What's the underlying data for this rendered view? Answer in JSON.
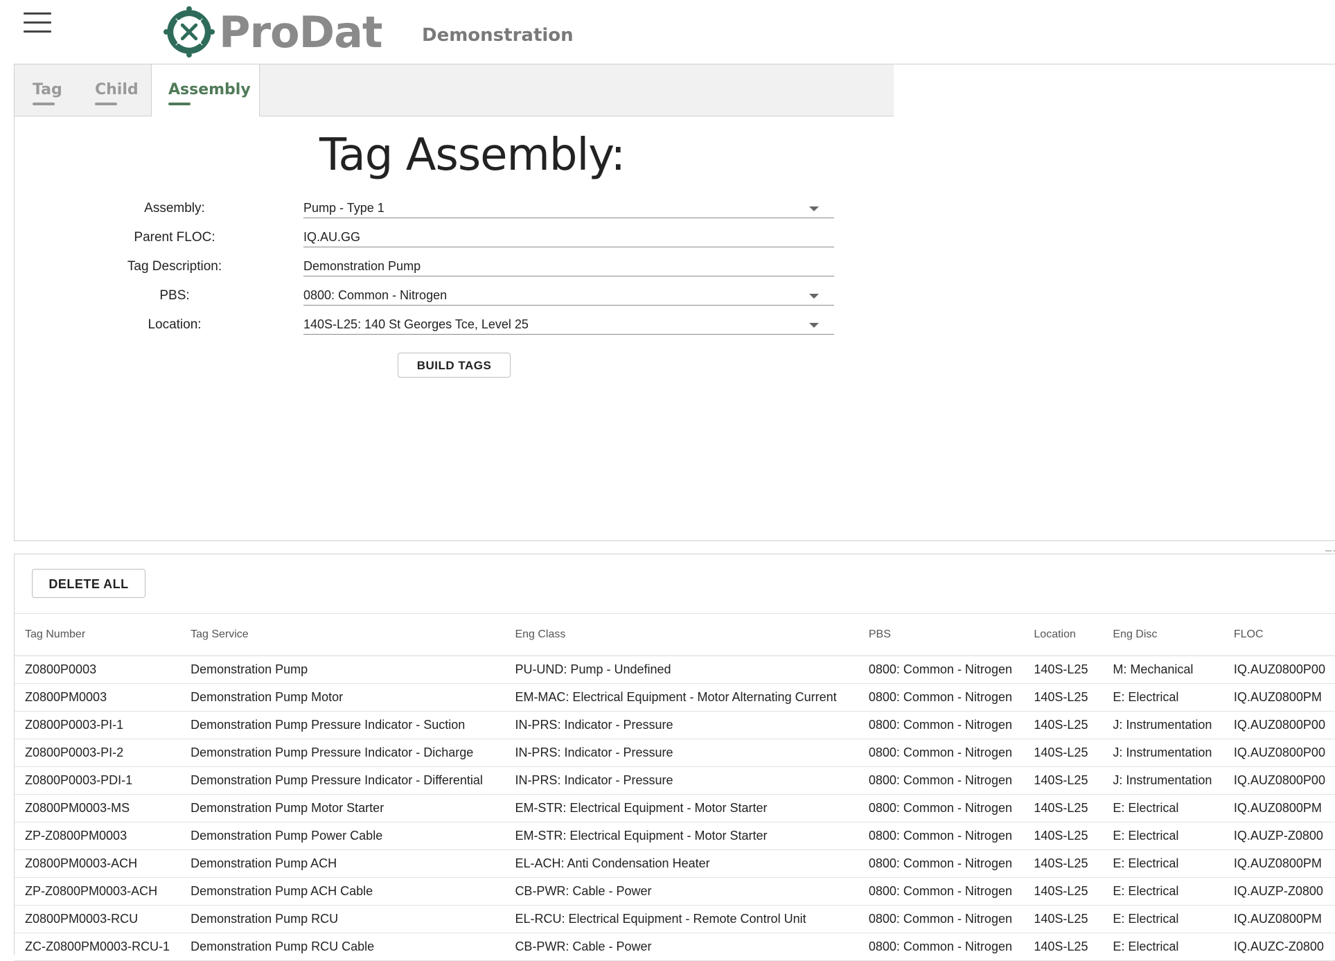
{
  "app": {
    "name": "ProDat",
    "environment": "Demonstration"
  },
  "tabs": [
    {
      "label": "Tag"
    },
    {
      "label": "Child"
    },
    {
      "label": "Assembly"
    }
  ],
  "form": {
    "title": "Tag Assembly:",
    "fields": [
      {
        "label": "Assembly:",
        "value": "Pump - Type 1"
      },
      {
        "label": "Parent FLOC:",
        "value": "IQ.AU.GG"
      },
      {
        "label": "Tag Description:",
        "value": "Demonstration Pump"
      },
      {
        "label": "PBS:",
        "value": "0800: Common - Nitrogen"
      },
      {
        "label": "Location:",
        "value": "140S-L25: 140 St Georges Tce, Level 25"
      }
    ],
    "build_label": "BUILD TAGS"
  },
  "splitter_text": "--- -",
  "grid": {
    "delete_all_label": "DELETE ALL",
    "columns": [
      "Tag Number",
      "Tag Service",
      "Eng Class",
      "PBS",
      "Location",
      "Eng Disc",
      "FLOC"
    ],
    "rows": [
      [
        "Z0800P0003",
        "Demonstration Pump",
        "PU-UND: Pump - Undefined",
        "0800: Common - Nitrogen",
        "140S-L25",
        "M: Mechanical",
        "IQ.AUZ0800P00"
      ],
      [
        "Z0800PM0003",
        "Demonstration Pump Motor",
        "EM-MAC: Electrical Equipment - Motor Alternating Current",
        "0800: Common - Nitrogen",
        "140S-L25",
        "E: Electrical",
        "IQ.AUZ0800PM"
      ],
      [
        "Z0800P0003-PI-1",
        "Demonstration Pump Pressure Indicator - Suction",
        "IN-PRS: Indicator - Pressure",
        "0800: Common - Nitrogen",
        "140S-L25",
        "J: Instrumentation",
        "IQ.AUZ0800P00"
      ],
      [
        "Z0800P0003-PI-2",
        "Demonstration Pump Pressure Indicator - Dicharge",
        "IN-PRS: Indicator - Pressure",
        "0800: Common - Nitrogen",
        "140S-L25",
        "J: Instrumentation",
        "IQ.AUZ0800P00"
      ],
      [
        "Z0800P0003-PDI-1",
        "Demonstration Pump Pressure Indicator - Differential",
        "IN-PRS: Indicator - Pressure",
        "0800: Common - Nitrogen",
        "140S-L25",
        "J: Instrumentation",
        "IQ.AUZ0800P00"
      ],
      [
        "Z0800PM0003-MS",
        "Demonstration Pump Motor Starter",
        "EM-STR: Electrical Equipment - Motor Starter",
        "0800: Common - Nitrogen",
        "140S-L25",
        "E: Electrical",
        "IQ.AUZ0800PM"
      ],
      [
        "ZP-Z0800PM0003",
        "Demonstration Pump Power Cable",
        "EM-STR: Electrical Equipment - Motor Starter",
        "0800: Common - Nitrogen",
        "140S-L25",
        "E: Electrical",
        "IQ.AUZP-Z0800"
      ],
      [
        "Z0800PM0003-ACH",
        "Demonstration Pump ACH",
        "EL-ACH: Anti Condensation Heater",
        "0800: Common - Nitrogen",
        "140S-L25",
        "E: Electrical",
        "IQ.AUZ0800PM"
      ],
      [
        "ZP-Z0800PM0003-ACH",
        "Demonstration Pump ACH Cable",
        "CB-PWR: Cable - Power",
        "0800: Common - Nitrogen",
        "140S-L25",
        "E: Electrical",
        "IQ.AUZP-Z0800"
      ],
      [
        "Z0800PM0003-RCU",
        "Demonstration Pump RCU",
        "EL-RCU: Electrical Equipment - Remote Control Unit",
        "0800: Common - Nitrogen",
        "140S-L25",
        "E: Electrical",
        "IQ.AUZ0800PM"
      ],
      [
        "ZC-Z0800PM0003-RCU-1",
        "Demonstration Pump RCU Cable",
        "CB-PWR: Cable - Power",
        "0800: Common - Nitrogen",
        "140S-L25",
        "E: Electrical",
        "IQ.AUZC-Z0800"
      ]
    ]
  }
}
